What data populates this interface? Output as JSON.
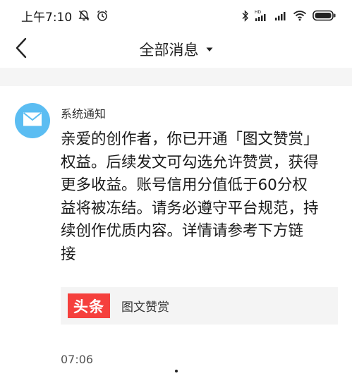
{
  "status_bar": {
    "time": "上午7:10",
    "icons": [
      "mute-icon",
      "alarm-icon",
      "bluetooth-icon",
      "hd-signal-icon",
      "signal-icon",
      "wifi-icon",
      "battery-icon"
    ]
  },
  "nav": {
    "back_icon": "chevron-left-icon",
    "title": "全部消息",
    "dropdown_icon": "caret-down-icon"
  },
  "message": {
    "avatar_icon": "envelope-icon",
    "avatar_color": "#5bbdf2",
    "sender": "系统通知",
    "body": "亲爱的创作者，你已开通「图文赞赏」\n权益。后续发文可勾选允许赞赏，获得\n更多收益。账号信用分值低于60分权\n益将被冻结。请务必遵守平台规范，持\n续创作优质内容。详情请参考下方链\n接",
    "card": {
      "logo_text": "头条",
      "logo_color": "#f5403d",
      "title": "图文赞赏"
    },
    "time": "07:06"
  }
}
